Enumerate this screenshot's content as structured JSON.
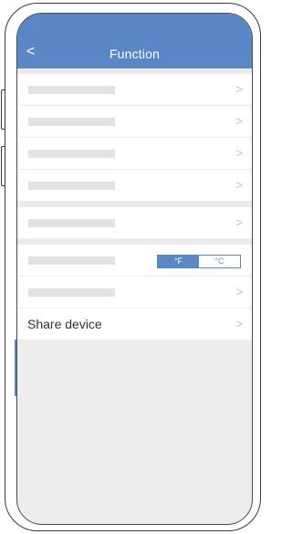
{
  "header": {
    "back_icon": "chevron-left-icon",
    "back_glyph": "<",
    "title": "Function"
  },
  "icons": {
    "chevron_glyph": ">"
  },
  "temperature_unit": {
    "options": [
      "°F",
      "°C"
    ],
    "selected": "°F"
  },
  "share_row": {
    "label": "Share device"
  },
  "colors": {
    "accent": "#5a87c6",
    "background": "#ededed"
  }
}
